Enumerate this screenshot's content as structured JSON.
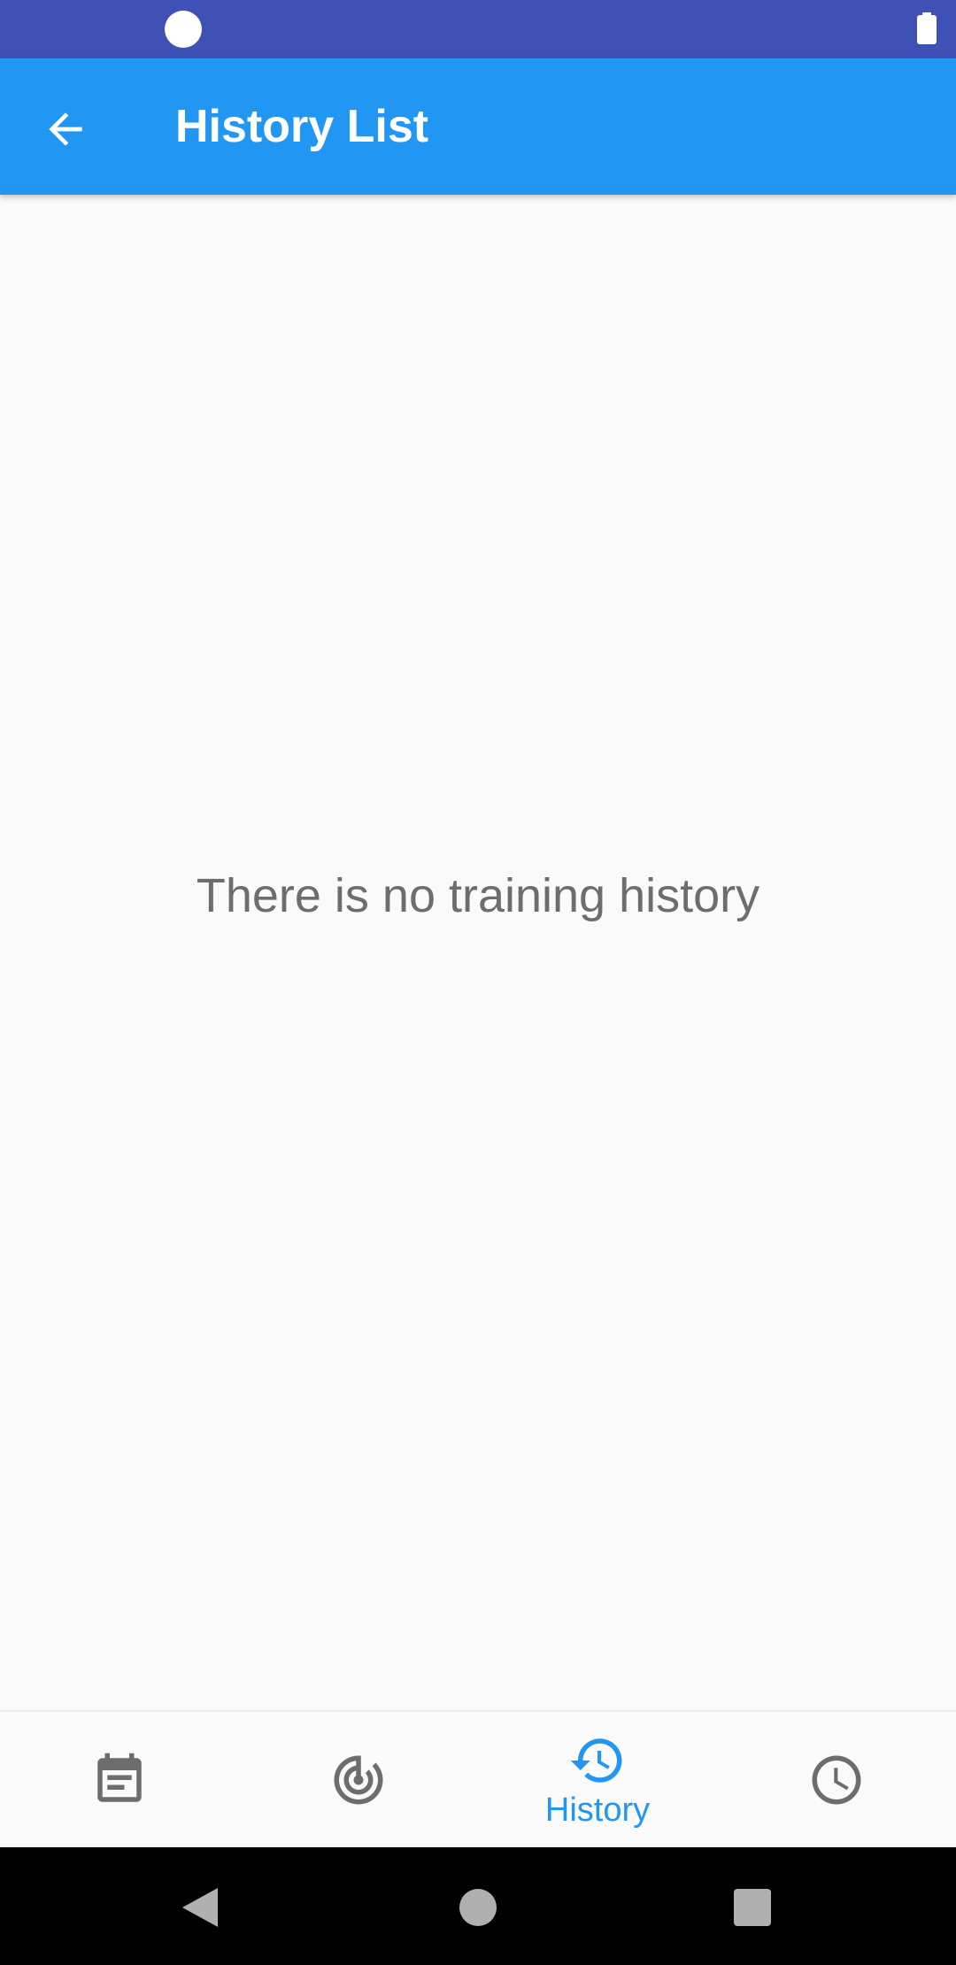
{
  "app_bar": {
    "title": "History List",
    "back_icon": "arrow-back-icon",
    "color": "#2196f3"
  },
  "status_bar": {
    "color": "#3f51b5"
  },
  "content": {
    "empty_message": "There is no training history"
  },
  "bottom_nav": {
    "active_color": "#2196f3",
    "inactive_color": "#6d6d6d",
    "items": [
      {
        "icon": "event-note-icon",
        "label": "",
        "active": false
      },
      {
        "icon": "track-changes-icon",
        "label": "",
        "active": false
      },
      {
        "icon": "history-icon",
        "label": "History",
        "active": true
      },
      {
        "icon": "clock-icon",
        "label": "",
        "active": false
      }
    ]
  },
  "system_nav": {
    "buttons": [
      "back-triangle-icon",
      "home-circle-icon",
      "recents-square-icon"
    ]
  }
}
